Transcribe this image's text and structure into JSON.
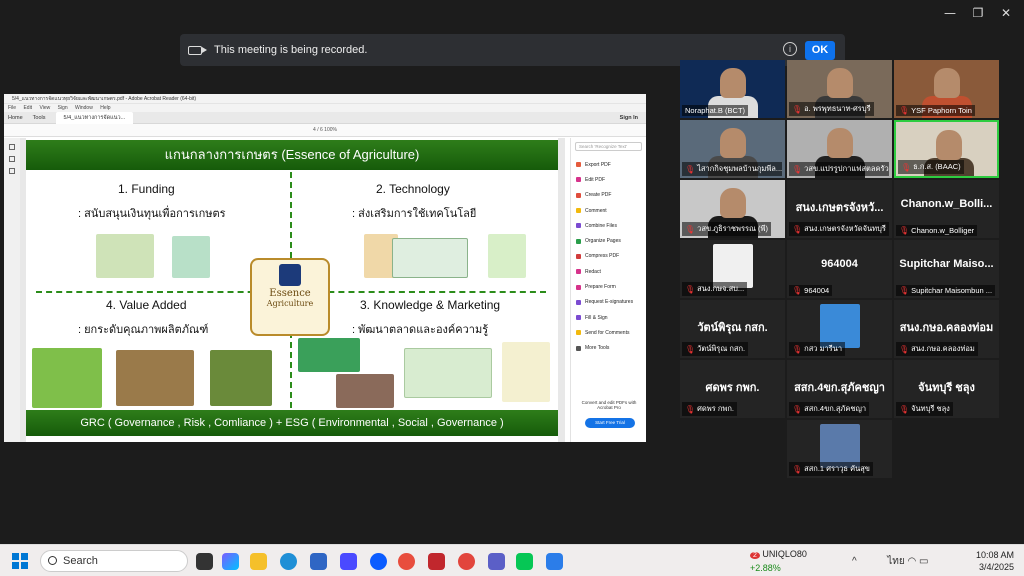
{
  "recording_banner": {
    "text": "This meeting is being recorded.",
    "ok_label": "OK"
  },
  "acrobat": {
    "title": "5/4_แนวทางการจัดแนวทุยวิจัยและพัฒนาเกษตร.pdf - Adobe Acrobat Reader (64-bit)",
    "menu": [
      "File",
      "Edit",
      "View",
      "Sign",
      "Window",
      "Help"
    ],
    "tabs": {
      "home": "Home",
      "tools": "Tools",
      "doc": "5/4_แนวทางการจัดแนว..."
    },
    "sign_in": "Sign In",
    "toolbar_text": "4  /  6        100%",
    "tools_search_placeholder": "Search 'Recognize Text'",
    "tools": [
      {
        "label": "Export PDF",
        "color": "#e55b3c"
      },
      {
        "label": "Edit PDF",
        "color": "#d6338b"
      },
      {
        "label": "Create PDF",
        "color": "#e04d3c"
      },
      {
        "label": "Comment",
        "color": "#f2b90d"
      },
      {
        "label": "Combine Files",
        "color": "#7b4bd1"
      },
      {
        "label": "Organize Pages",
        "color": "#2a9d4a"
      },
      {
        "label": "Compress PDF",
        "color": "#d13c3c"
      },
      {
        "label": "Redact",
        "color": "#d6338b"
      },
      {
        "label": "Prepare Form",
        "color": "#d6338b"
      },
      {
        "label": "Request E-signatures",
        "color": "#7b4bd1"
      },
      {
        "label": "Fill & Sign",
        "color": "#7b4bd1"
      },
      {
        "label": "Send for Comments",
        "color": "#f2b90d"
      },
      {
        "label": "More Tools",
        "color": "#555555"
      }
    ],
    "promo": "Convert and edit PDFs with Acrobat Pro",
    "trial": "Start Free Trial"
  },
  "slide": {
    "title": "แกนกลางการเกษตร (Essence of Agriculture)",
    "q1_head": "1.      Funding",
    "q1_sub": ": สนับสนุนเงินทุนเพื่อการเกษตร",
    "q2_head": "2. Technology",
    "q2_sub": ": ส่งเสริมการใช้เทคโนโลยี",
    "q3_head": "4. Value Added",
    "q3_sub": ": ยกระดับคุณภาพผลิตภัณฑ์",
    "q4_head": "3. Knowledge & Marketing",
    "q4_sub": ": พัฒนาตลาดและองค์ความรู้",
    "emblem_line1": "Essence",
    "emblem_line2": "Agriculture",
    "footer": "GRC ( Governance , Risk , Comliance )  +  ESG ( Environmental , Social , Governance )"
  },
  "participants": [
    {
      "big": "",
      "label": "Noraphat.B (BCT)",
      "muted": false,
      "video": true
    },
    {
      "big": "",
      "label": "อ. พรพุทธนาท-ศรบุรี",
      "muted": true,
      "video": true
    },
    {
      "big": "",
      "label": "YSF Paphorn Toin",
      "muted": true,
      "video": true
    },
    {
      "big": "",
      "label": "ไสากกิจชุมพลบ้านกุมพีล...",
      "muted": true,
      "video": true
    },
    {
      "big": "",
      "label": "วสข.แปรรูปกาแฟสตลครัว...",
      "muted": true,
      "video": true
    },
    {
      "big": "",
      "label": "ธ.ก.ส. (BAAC)",
      "muted": true,
      "video": true
    },
    {
      "big": "",
      "label": "วสข.ภูธิราชพรรณ (พี)",
      "muted": true,
      "video": true
    },
    {
      "big": "สนง.เกษตรจังหวั...",
      "label": "สนง.เกษตรจังหวัดจันทบุรี",
      "muted": true,
      "video": false
    },
    {
      "big": "Chanon.w_Bolli...",
      "label": "Chanon.w_Bolliger",
      "muted": true,
      "video": false
    },
    {
      "big": "",
      "label": "สนง.กษจ.สบ...",
      "muted": true,
      "video": false
    },
    {
      "big": "964004",
      "label": "964004",
      "muted": true,
      "video": false
    },
    {
      "big": "Supitchar  Maiso...",
      "label": "Supitchar Maisombun ...",
      "muted": true,
      "video": false
    },
    {
      "big": "วัตน์พิรุณ กสก.",
      "label": "วัตน์พิรุณ กสก.",
      "muted": true,
      "video": false
    },
    {
      "big": "",
      "label": "กสว มารีนา",
      "muted": true,
      "video": false
    },
    {
      "big": "สนง.กษอ.คลองท่อม",
      "label": "สนง.กษอ.คลองท่อม",
      "muted": true,
      "video": false
    },
    {
      "big": "ศดพร กพก.",
      "label": "ศดพร กพก.",
      "muted": true,
      "video": false
    },
    {
      "big": "สสก.4ขก.สุภัคชญา",
      "label": "สสก.4ขก.สุภัคชญา",
      "muted": true,
      "video": false
    },
    {
      "big": "จันทบุรี ชลุง",
      "label": "จันทบุรี ชลุง",
      "muted": true,
      "video": false
    },
    {
      "big": "",
      "label": "สสก.1 ศราวุธ คันสุข",
      "muted": true,
      "video": false
    }
  ],
  "taskbar": {
    "search": "Search",
    "stock_name": "UNIQLO80",
    "stock_change": "+2.88%",
    "badge": "2",
    "lang": "ไทย",
    "time": "10:08 AM",
    "date": "3/4/2025"
  }
}
